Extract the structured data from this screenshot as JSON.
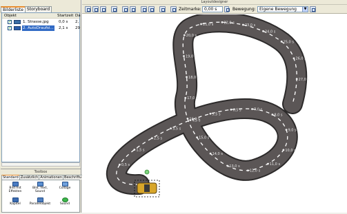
{
  "left": {
    "tabs": [
      "Bilderliste",
      "Storyboard"
    ],
    "columns": [
      "Objekt",
      "Startzeit",
      "Da"
    ],
    "rows": [
      {
        "name": "1. Strasse.jpg",
        "start": "0,0 s",
        "dur": "2,"
      },
      {
        "name": "2. AutoDraufsi...",
        "start": "2,1 s",
        "dur": "29"
      }
    ]
  },
  "toolbox": {
    "title": "Toolbox",
    "tabs": [
      "Standard",
      "Zusätzlich",
      "Animationen",
      "Beschriftu"
    ],
    "tools": [
      {
        "icon": "image-on-image-icon",
        "label1": "Bild mit",
        "label2": "Effekten"
      },
      {
        "icon": "image-text-sound-icon",
        "label1": "Bild, Text,",
        "label2": "Sound"
      },
      {
        "icon": "collage-icon",
        "label1": "Collage",
        "label2": ""
      },
      {
        "icon": "chapter-icon",
        "label1": "Kapitel",
        "label2": ""
      },
      {
        "icon": "parallax-icon",
        "label1": "Parallelobjekt",
        "label2": ""
      },
      {
        "icon": "sound-icon",
        "label1": "Sound",
        "label2": ""
      }
    ]
  },
  "right": {
    "title": "Layoutdesigner",
    "zeitmarke_label": "Zeitmarke:",
    "zeitmarke_value": "0,00 s",
    "bewegung_label": "Bewegung:",
    "bewegung_value": "Eigene Bewegung"
  },
  "waypoints": [
    "0,5 s",
    "1,5 s",
    "2,5 s",
    "3,5 s",
    "4,5 s",
    "5,5 s",
    "6,5 s",
    "7,0 s",
    "8,0 s",
    "9,0 s",
    "10,0 s",
    "11,0 s",
    "12,0 s",
    "13,0 s",
    "14,0 s",
    "15,0 s",
    "16,0 s",
    "17,0 s",
    "18,0 s",
    "19,0 s",
    "20,0 s",
    "21,0 s",
    "22,0 s",
    "23,0 s",
    "24,0 s",
    "25,0 s",
    "26,0 s",
    "27,0 s"
  ],
  "colors": {
    "road": "#5b5656",
    "road_edge": "#2c2a2a",
    "dash": "#ffffff",
    "car": "#d8a62a",
    "accent": "#e68b2c"
  }
}
